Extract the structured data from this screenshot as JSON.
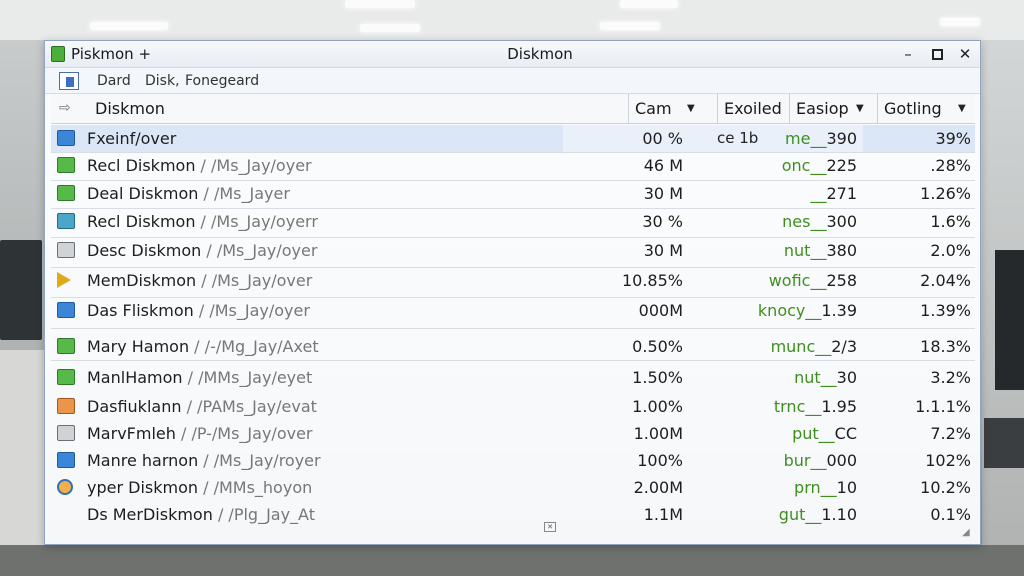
{
  "window": {
    "title_left": "Piskmon +",
    "title_center": "Diskmon",
    "minimize": "–",
    "close": "✕"
  },
  "menu": [
    "Dard",
    "Disk,",
    "Fonegeard"
  ],
  "header": {
    "title": "Diskmon",
    "columns": [
      "Cam",
      "Exoiled",
      "Easiop",
      "Gotling"
    ],
    "dropdown_glyph": "▼"
  },
  "rows": [
    {
      "name": "Fxeinf/over",
      "path": "",
      "size": "00 %",
      "tag": "ce 1b",
      "code_prefix": "me",
      "code_num": "390",
      "pct": "39%",
      "icon": "disk-icon",
      "selected": true
    },
    {
      "name": "Recl Diskmon",
      "path": " / /Ms_Jay/oyer",
      "size": "46 M",
      "tag": "",
      "code_prefix": "onc",
      "code_num": "225",
      "pct": ".28%",
      "icon": "arrow-icon"
    },
    {
      "name": "Deal Diskmon",
      "path": " / /Ms_Jayer",
      "size": "30 M",
      "tag": "",
      "code_prefix": "",
      "code_num": "271",
      "pct": "1.26%",
      "icon": "arrow-icon"
    },
    {
      "name": "Recl Diskmon",
      "path": " / /Ms_Jay/oyerr",
      "size": "30 %",
      "tag": "",
      "code_prefix": "nes",
      "code_num": "300",
      "pct": "1.6%",
      "icon": "folder-icon"
    },
    {
      "name": "Desc Diskmon",
      "path": " / /Ms_Jay/oyer",
      "size": "30 M",
      "tag": "",
      "code_prefix": "nut",
      "code_num": "380",
      "pct": "2.0%",
      "icon": "drive-icon"
    },
    {
      "name": "MemDiskmon",
      "path": " / /Ms_Jay/over",
      "size": "10.85%",
      "tag": "",
      "code_prefix": "wofic",
      "code_num": "258",
      "pct": "2.04%",
      "icon": "play-icon"
    },
    {
      "name": "Das Fliskmon",
      "path": " / /Ms_Jay/oyer",
      "size": "000M",
      "tag": "",
      "code_prefix": "knocy",
      "code_num": "1.39",
      "pct": "1.39%",
      "icon": "disk-icon"
    },
    {
      "name": "Mary Hamon",
      "path": " / /-/Mg_Jay/Axet",
      "size": "0.50%",
      "tag": "",
      "code_prefix": "munc",
      "code_num": "2/3",
      "pct": "18.3%",
      "icon": "network-icon"
    },
    {
      "name": "ManlHamon",
      "path": " / /MMs_Jay/eyet",
      "size": "1.50%",
      "tag": "",
      "code_prefix": "nut",
      "code_num": "30",
      "pct": "3.2%",
      "icon": "network-icon"
    },
    {
      "name": "Dasfiuklann",
      "path": " / /PAMs_Jay/evat",
      "size": "1.00%",
      "tag": "",
      "code_prefix": "trnc",
      "code_num": "1.95",
      "pct": "1.1.1%",
      "icon": "book-icon"
    },
    {
      "name": "MarvFmleh",
      "path": " / /P-/Ms_Jay/over",
      "size": "1.00M",
      "tag": "",
      "code_prefix": "put",
      "code_num": "CC",
      "pct": "7.2%",
      "icon": "computer-icon"
    },
    {
      "name": "Manre harnon",
      "path": " / /Ms_Jay/royer",
      "size": "100%",
      "tag": "",
      "code_prefix": "bur",
      "code_num": "000",
      "pct": "102%",
      "icon": "image-icon"
    },
    {
      "name": "yper Diskmon",
      "path": " / /MMs_hoyon",
      "size": "2.00M",
      "tag": "",
      "code_prefix": "prn",
      "code_num": "10",
      "pct": "10.2%",
      "icon": "disc-icon"
    },
    {
      "name": "Ds MerDiskmon",
      "path": " / /Plg_Jay_At",
      "size": "1.1M",
      "tag": "",
      "code_prefix": "gut",
      "code_num": "1.10",
      "pct": "0.1%",
      "icon": "none"
    }
  ]
}
